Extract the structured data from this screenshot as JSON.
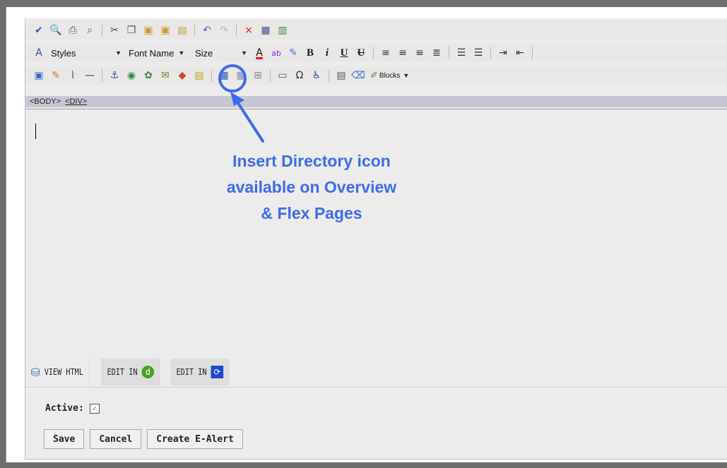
{
  "toolbar_row2": {
    "styles_label": "Styles",
    "font_name_label": "Font Name",
    "size_label": "Size",
    "bold": "B",
    "italic": "i",
    "underline": "U",
    "strike": "U"
  },
  "toolbar_row3": {
    "blocks_label": "Blocks"
  },
  "path": [
    "<BODY>",
    "<DIV>"
  ],
  "annotation": {
    "line1": "Insert Directory icon",
    "line2": "available on Overview",
    "line3": "& Flex Pages",
    "color": "#3b6bf0"
  },
  "tabs": {
    "view_html": "VIEW HTML",
    "edit_in_1": "EDIT IN",
    "edit_in_2": "EDIT IN"
  },
  "active_label": "Active:",
  "active_checked": true,
  "buttons": {
    "save": "Save",
    "cancel": "Cancel",
    "create_ealert": "Create E-Alert"
  }
}
